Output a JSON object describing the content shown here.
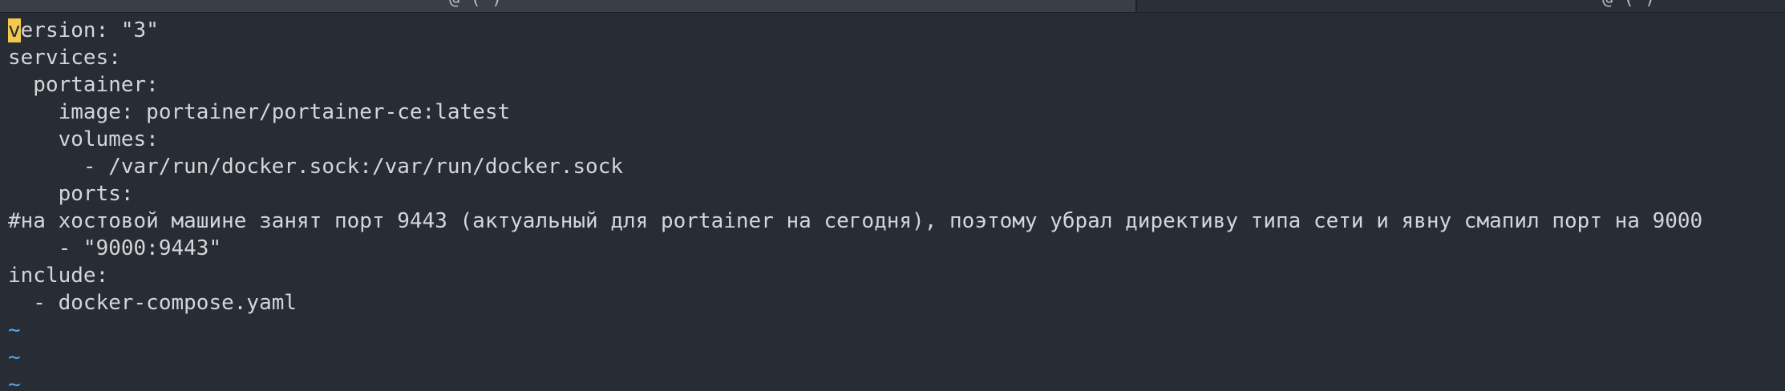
{
  "tabs": [
    {
      "label": "@ ( )"
    },
    {
      "label": "@ ( )"
    }
  ],
  "editor": {
    "cursor_char": "v",
    "lines": [
      "version: \"3\"",
      "services:",
      "  portainer:",
      "    image: portainer/portainer-ce:latest",
      "    volumes:",
      "      - /var/run/docker.sock:/var/run/docker.sock",
      "    ports:",
      "#на хостовой машине занят порт 9443 (актуальный для portainer на сегодня), поэтому убрал директиву типа сети и явну смапил порт на 9000",
      "    - \"9000:9443\"",
      "include:",
      "  - docker-compose.yaml"
    ],
    "first_line_rest": "ersion: \"3\"",
    "empty_line_marker": "~"
  }
}
